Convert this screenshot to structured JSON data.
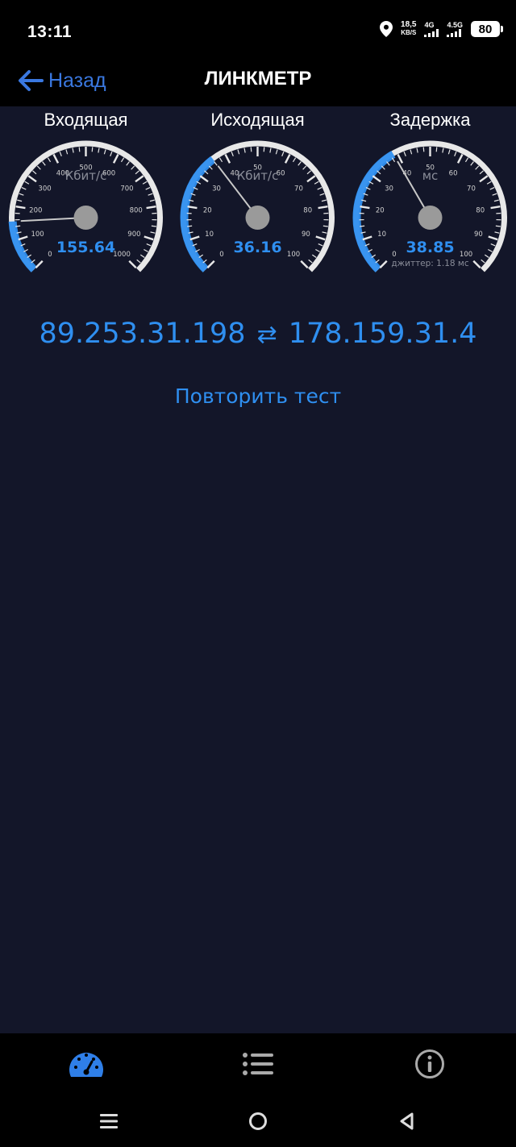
{
  "status_bar": {
    "time": "13:11",
    "net_speed_value": "18,5",
    "net_speed_unit": "KB/S",
    "signal1_label": "4G",
    "signal2_label": "4.5G",
    "battery": "80"
  },
  "app_bar": {
    "back_label": "Назад",
    "title": "ЛИНКМЕТР"
  },
  "gauges": [
    {
      "title": "Входящая",
      "unit": "Кбит/с",
      "value": "155.64",
      "numeric_value": 155.64,
      "max": 1000,
      "ticks": [
        "0",
        "100",
        "200",
        "300",
        "400",
        "500",
        "600",
        "700",
        "800",
        "900",
        "1000"
      ],
      "note": ""
    },
    {
      "title": "Исходящая",
      "unit": "Кбит/с",
      "value": "36.16",
      "numeric_value": 36.16,
      "max": 100,
      "ticks": [
        "0",
        "10",
        "20",
        "30",
        "40",
        "50",
        "60",
        "70",
        "80",
        "90",
        "100"
      ],
      "note": ""
    },
    {
      "title": "Задержка",
      "unit": "мс",
      "value": "38.85",
      "numeric_value": 38.85,
      "max": 100,
      "ticks": [
        "0",
        "10",
        "20",
        "30",
        "40",
        "50",
        "60",
        "70",
        "80",
        "90",
        "100"
      ],
      "note": "джиттер: 1.18 мс"
    }
  ],
  "connection": {
    "local_ip": "89.253.31.198",
    "arrow": "⇄",
    "remote_ip": "178.159.31.4"
  },
  "retest_label": "Повторить тест",
  "colors": {
    "accent": "#2f8ff0",
    "background": "#131629",
    "gauge_ring": "#e8e8e8",
    "hub": "#9a9a9a"
  }
}
